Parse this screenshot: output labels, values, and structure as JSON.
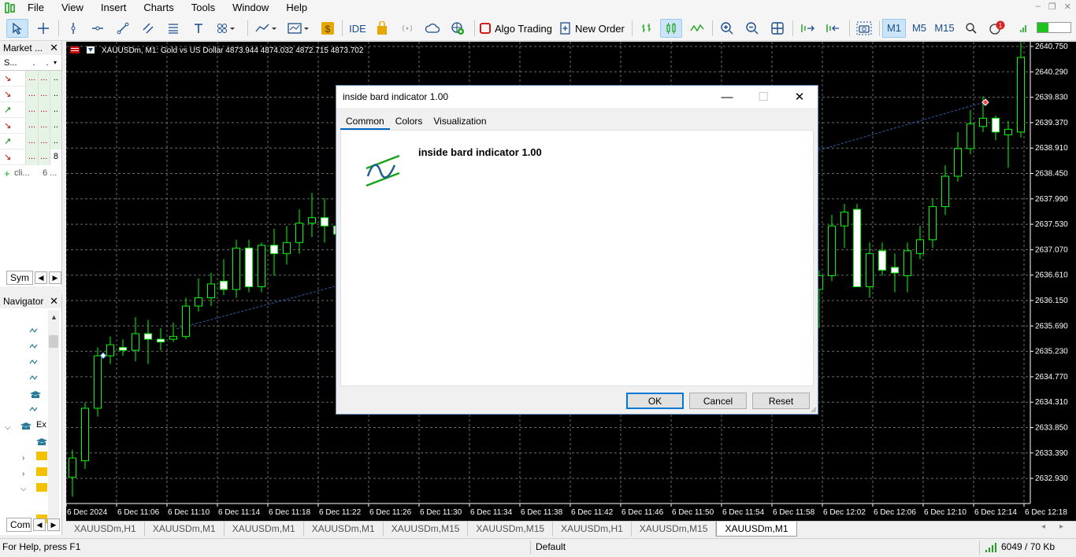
{
  "menu": [
    "File",
    "View",
    "Insert",
    "Charts",
    "Tools",
    "Window",
    "Help"
  ],
  "toolbar": {
    "algo_trading": "Algo Trading",
    "new_order": "New Order",
    "ide": "IDE",
    "timeframes": [
      "M1",
      "M5",
      "M15"
    ],
    "active_timeframe": "M1",
    "notification_count": "1"
  },
  "market_watch": {
    "title": "Market ...",
    "symbol_header": "S...",
    "header_dot1": ".",
    "header_dot2": ".",
    "rows": [
      {
        "dir": "↘",
        "c1": "...",
        "c2": "...",
        "c3": ".."
      },
      {
        "dir": "↘",
        "c1": "...",
        "c2": "...",
        "c3": ".."
      },
      {
        "dir": "↗",
        "c1": "...",
        "c2": "...",
        "c3": ".."
      },
      {
        "dir": "↘",
        "c1": "...",
        "c2": "...",
        "c3": ".."
      },
      {
        "dir": "↗",
        "c1": "...",
        "c2": "...",
        "c3": ".."
      },
      {
        "dir": "↘",
        "c1": "...",
        "c2": "...",
        "c3": "8"
      }
    ],
    "add_label": "cli...",
    "add_count": "6 ...",
    "tab": "Sym"
  },
  "navigator": {
    "title": "Navigator",
    "expert_label": "Ex",
    "tab": "Com"
  },
  "chart": {
    "header": "XAUUSDm, M1:  Gold vs US Dollar  4873.944 4874.032 4872.715 4873.702",
    "price_labels": [
      "2640.750",
      "2640.290",
      "2639.830",
      "2639.370",
      "2638.910",
      "2638.450",
      "2637.990",
      "2637.530",
      "2637.070",
      "2636.610",
      "2636.150",
      "2635.690",
      "2635.230",
      "2634.770",
      "2634.310",
      "2633.850",
      "2633.390",
      "2632.930"
    ],
    "time_labels": [
      "6 Dec 2024",
      "6 Dec 11:06",
      "6 Dec 11:10",
      "6 Dec 11:14",
      "6 Dec 11:18",
      "6 Dec 11:22",
      "6 Dec 11:26",
      "6 Dec 11:30",
      "6 Dec 11:34",
      "6 Dec 11:38",
      "6 Dec 11:42",
      "6 Dec 11:46",
      "6 Dec 11:50",
      "6 Dec 11:54",
      "6 Dec 11:58",
      "6 Dec 12:02",
      "6 Dec 12:06",
      "6 Dec 12:10",
      "6 Dec 12:14",
      "6 Dec 12:18"
    ],
    "up_color": "#00ff00",
    "down_color": "#ffffff"
  },
  "dialog": {
    "title": "inside bard indicator 1.00",
    "tabs": [
      "Common",
      "Colors",
      "Visualization"
    ],
    "indicator_name": "inside bard indicator 1.00",
    "ok": "OK",
    "cancel": "Cancel",
    "reset": "Reset"
  },
  "chart_tabs": [
    "XAUUSDm,H1",
    "XAUUSDm,M1",
    "XAUUSDm,M1",
    "XAUUSDm,M1",
    "XAUUSDm,M15",
    "XAUUSDm,M15",
    "XAUUSDm,H1",
    "XAUUSDm,M15",
    "XAUUSDm,M1"
  ],
  "active_chart_tab": 8,
  "status": {
    "help": "For Help, press F1",
    "profile": "Default",
    "traffic": "6049 / 70 Kb"
  }
}
